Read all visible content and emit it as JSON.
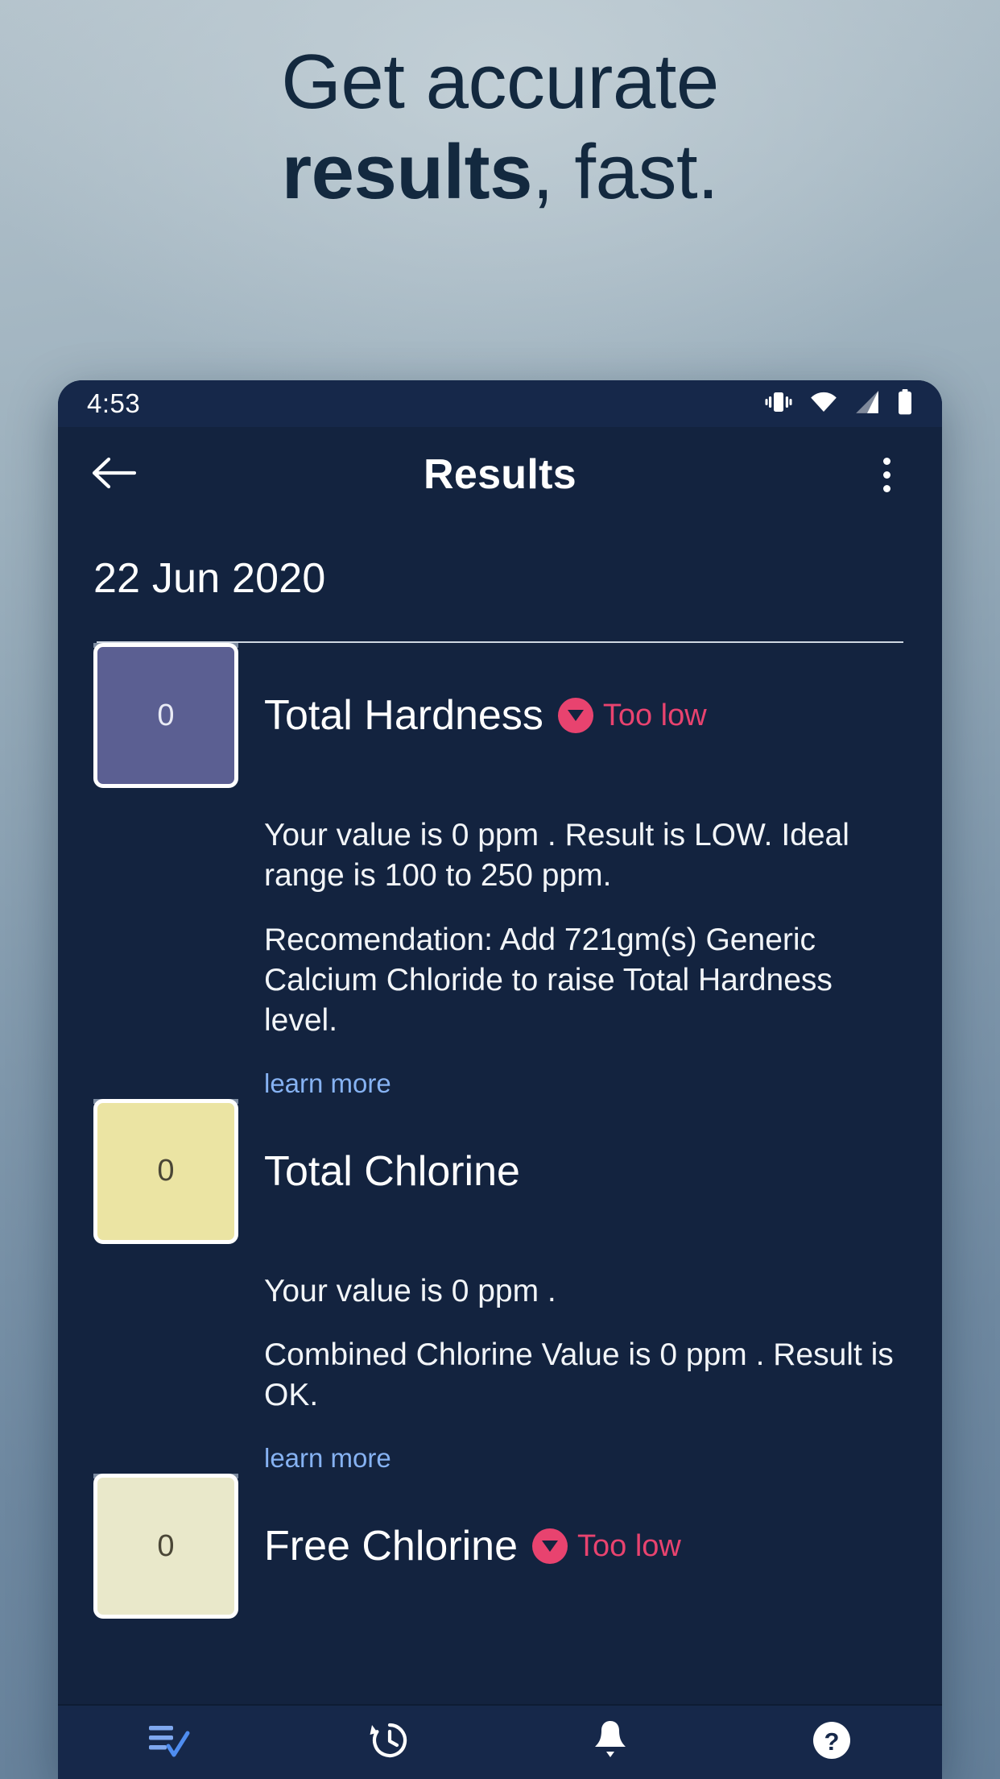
{
  "promo": {
    "line1": "Get accurate",
    "line2_strong": "results",
    "line2_rest": ", fast."
  },
  "colors": {
    "page_bg_top": "#b4c3cc",
    "page_bg_bottom": "#637e98",
    "promo_text": "#13293f",
    "app_bg": "#13233f",
    "statusbar_bg": "#16284a",
    "accent_low": "#e8436f",
    "link": "#86b2f2",
    "rail": "#7d8ca1",
    "nav_active": "#7fa8ef"
  },
  "statusbar": {
    "time": "4:53",
    "icons": [
      "vibrate-icon",
      "wifi-icon",
      "cell-signal-icon",
      "battery-icon"
    ]
  },
  "appbar": {
    "back_icon": "arrow-left-icon",
    "title": "Results",
    "overflow_icon": "more-vertical-icon"
  },
  "screen": {
    "date": "22 Jun 2020"
  },
  "results": [
    {
      "name": "Total Hardness",
      "value": "0",
      "swatch_color": "#5b5f92",
      "swatch_text_color": "#e9ebf5",
      "status": "Too low",
      "status_icon": "triangle-down-icon",
      "has_status": true,
      "paragraphs": [
        "Your value is 0 ppm . Result is LOW. Ideal range is 100 to 250 ppm.",
        "Recomendation: Add 721gm(s) Generic Calcium Chloride to raise Total Hardness level."
      ],
      "link": "learn more"
    },
    {
      "name": "Total Chlorine",
      "value": "0",
      "swatch_color": "#ebe4a3",
      "swatch_text_color": "#4a4636",
      "status": "",
      "status_icon": "",
      "has_status": false,
      "paragraphs": [
        "Your value is 0 ppm .",
        "Combined Chlorine Value is 0 ppm . Result is OK."
      ],
      "link": "learn more"
    },
    {
      "name": "Free Chlorine",
      "value": "0",
      "swatch_color": "#e9e8ca",
      "swatch_text_color": "#4a4636",
      "status": "Too low",
      "status_icon": "triangle-down-icon",
      "has_status": true,
      "paragraphs": [],
      "link": ""
    }
  ],
  "bottom_nav": [
    {
      "icon": "playlist-check-icon",
      "active": true
    },
    {
      "icon": "history-icon",
      "active": false
    },
    {
      "icon": "bell-icon",
      "active": false
    },
    {
      "icon": "help-circle-icon",
      "active": false
    }
  ]
}
